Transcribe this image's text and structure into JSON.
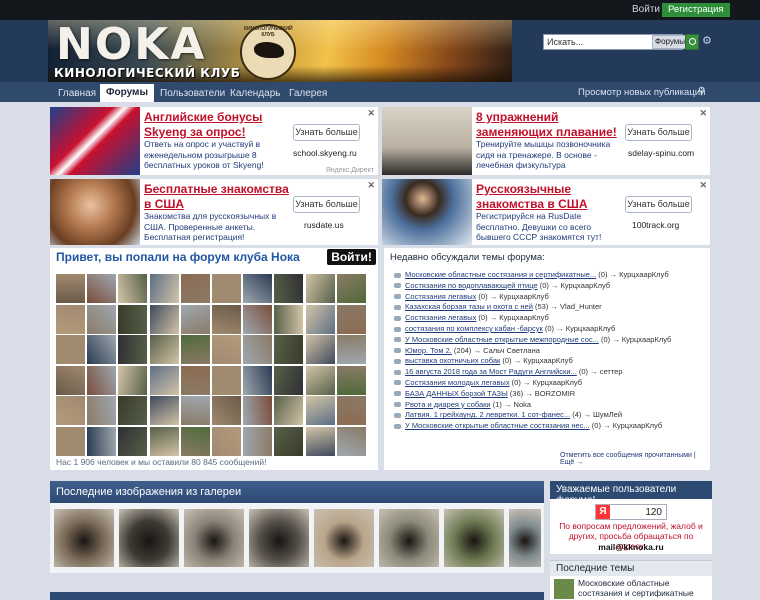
{
  "topbar": {
    "login": "Войти",
    "register": "Регистрация"
  },
  "header": {
    "logo": "NOKA",
    "subtitle": "КИНОЛОГИЧЕСКИЙ КЛУБ",
    "emblem_text": "КИНОЛОГИЧЕСКИЙ КЛУБ",
    "search_placeholder": "Искать...",
    "search_scope": "Форумы"
  },
  "nav": {
    "tabs": [
      "Главная",
      "Форумы",
      "Пользователи",
      "Календарь",
      "Галерея"
    ],
    "active": "Форумы",
    "new_posts": "Просмотр новых публикаций"
  },
  "ads": [
    {
      "title": "Английские бонусы Skyeng за опрос!",
      "desc": "Ответь на опрос и участвуй в еженедельном розыгрыше 8 бесплатных уроков от Skyeng!",
      "cta": "Узнать больше",
      "domain": "school.skyeng.ru",
      "direct": "Яндекс.Директ",
      "img_color": "#9c2c2c"
    },
    {
      "title": "8 упражнений заменяющих плавание!",
      "desc": "Тренируйте мышцы позвоночника сидя на тренажере. В основе - лечебная физкультура",
      "cta": "Узнать больше",
      "domain": "sdelay-spinu.com",
      "img_color": "#cfc7b8"
    },
    {
      "title": "Бесплатные знакомства в США",
      "desc": "Знакомства для русскоязычных в США. Проверенные анкеты. Бесплатная регистрация!",
      "cta": "Узнать больше",
      "domain": "rusdate.us",
      "img_color": "#b57b52"
    },
    {
      "title": "Русскоязычные знакомства в США",
      "desc": "Регистрируйся на RusDate бесплатно. Девушки со всего бывшего СССР знакомятся тут!",
      "cta": "Узнать больше",
      "domain": "100track.org",
      "img_color": "#4a6d9a"
    }
  ],
  "welcome": {
    "title": "Привет, вы попали на форум клуба Нока",
    "enter": "Войти!",
    "stats": "Нас 1 906 человек и мы оставили 80 845 сообщений!"
  },
  "recent": {
    "title": "Недавно обсуждали темы форума:",
    "items": [
      {
        "topic": "Московские областные состязания и сертификатные...",
        "meta": " (0) → КурцхаарКлуб"
      },
      {
        "topic": "Состязания по водоплавающей птице",
        "meta": " (0) → КурцхаарКлуб"
      },
      {
        "topic": "Состязания легавых",
        "meta": " (0) → КурцхаарКлуб"
      },
      {
        "topic": "Казахская борзая тазы и охота с ней",
        "meta": " (53) → Vlad_Hunter"
      },
      {
        "topic": "Состязания легавых",
        "meta": " (0) → КурцхаарКлуб"
      },
      {
        "topic": "состязания по комплексу кабан -барсук",
        "meta": " (0) → КурцхаарКлуб"
      },
      {
        "topic": "У Московские областные открытые межпородные сос...",
        "meta": " (0) → КурцхаарКлуб"
      },
      {
        "topic": "Юмор. Том 2.",
        "meta": " (204) → Сальч Светлана"
      },
      {
        "topic": "выставка охотничьих собак",
        "meta": " (0) → КурцхаарКлуб"
      },
      {
        "topic": "16 августа 2018 года за Мост Радуги Английски...",
        "meta": " (0) → сеттер"
      },
      {
        "topic": "Состязания молодых легавых",
        "meta": " (0) → КурцхаарКлуб"
      },
      {
        "topic": "БАЗА ДАННЫХ борзой ТАЗЫ",
        "meta": " (36) → BORZOMIR"
      },
      {
        "topic": "Рвота и диарея у собаки",
        "meta": " (1) → Noka"
      },
      {
        "topic": "Латвия. 1 грейхаунд. 2 левретки. 1 сот-фанес...",
        "meta": " (4) → ШумЛей"
      },
      {
        "topic": "У Московские открытые областные состязания нес...",
        "meta": " (0) → КурцхаарКлуб"
      }
    ],
    "footer": "Отметить все сообщения прочитанными | Ещё →"
  },
  "gallery": {
    "title": "Последние изображения из галереи",
    "photos": [
      "#7a6a58",
      "#3e3a34",
      "#8a8278",
      "#55504a",
      "#b9a58a",
      "#8c8a7a",
      "#6d7a52",
      "#7e8a8c"
    ]
  },
  "sidebar": {
    "users_title": "Уважаемые пользователи форума!",
    "ya_letter": "Я",
    "counter": "120",
    "message": "По вопросам предложений, жалоб и других, просьба обращаться по адресу:",
    "email": "mail@kknoka.ru",
    "latest_title": "Последние темы",
    "latest_text": "Московские областные состязания и сертификатные испытания"
  },
  "colors": {
    "brand": "#2f4a6d",
    "accent": "#2d8f3a",
    "ad_title": "#c0102a",
    "link": "#1f3b7a"
  }
}
